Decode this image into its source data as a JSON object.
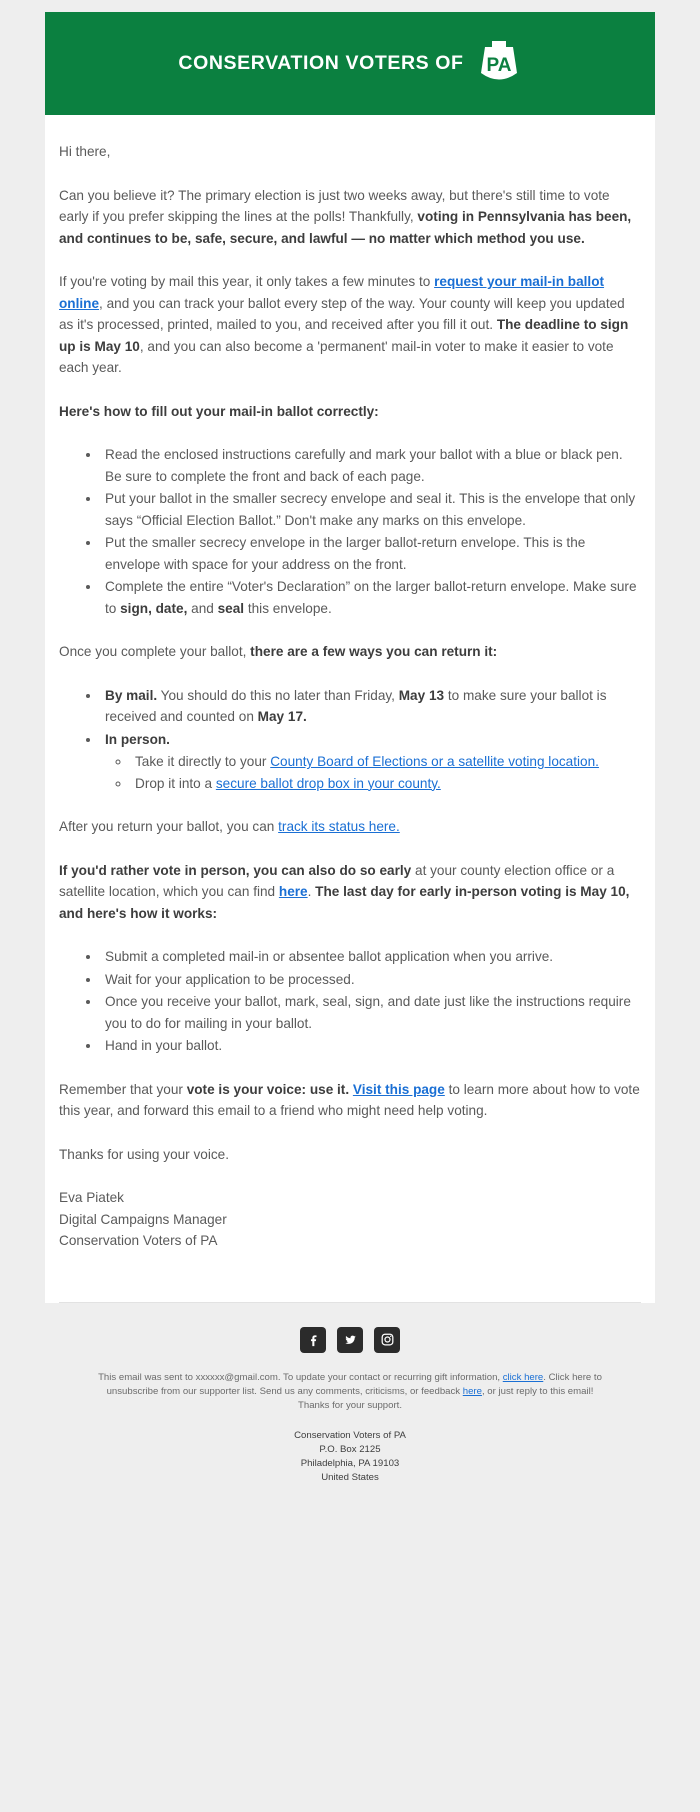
{
  "header": {
    "brand_text": "CONSERVATION VOTERS OF",
    "keystone_label": "PA"
  },
  "body": {
    "greeting": "Hi there,",
    "p1_a": "Can you believe it? The primary election is just two weeks away, but there's still time to vote early if you prefer skipping the lines at the polls! Thankfully, ",
    "p1_bold": "voting in Pennsylvania has been, and continues to be, safe, secure, and lawful — no matter which method you use.",
    "p2_a": "If you're voting by mail this year, it only takes a few minutes to ",
    "p2_link": "request your mail-in ballot online",
    "p2_b": ", and you can track your ballot every step of the way. Your county will keep you updated as it's processed, printed, mailed to you, and received after you fill it out. ",
    "p2_bold": "The deadline to sign up is May 10",
    "p2_c": ", and you can also become a 'permanent' mail-in voter to make it easier to vote each year.",
    "howto_heading": "Here's how to fill out your mail-in ballot correctly:",
    "howto_items": [
      {
        "text": "Read the enclosed instructions carefully and mark your ballot with a blue or black pen. Be sure to complete the front and back of each page."
      },
      {
        "text": "Put your ballot in the smaller secrecy envelope and seal it. This is the envelope that only says “Official Election Ballot.” Don't make any marks on this envelope."
      },
      {
        "text": "Put the smaller secrecy envelope in the larger ballot-return envelope. This is the envelope with space for your address on the front."
      }
    ],
    "howto_last_a": "Complete the entire “Voter's Declaration” on the larger ballot-return envelope. Make sure to ",
    "howto_last_b1": "sign, date,",
    "howto_last_b2": " and ",
    "howto_last_b3": "seal",
    "howto_last_b4": " this envelope.",
    "return_intro_a": "Once you complete your ballot, ",
    "return_intro_bold": "there are a few ways you can return it:",
    "bymail_bold": "By mail.",
    "bymail_a": " You should do this no later than Friday, ",
    "bymail_date1": "May 13",
    "bymail_b": " to make sure your ballot is received and counted on ",
    "bymail_date2": "May 17.",
    "inperson_bold": "In person.",
    "sub1_a": "Take it directly to your ",
    "sub1_link": "County Board of Elections or a satellite voting location.",
    "sub2_a": "Drop it into a ",
    "sub2_link": "secure ballot drop box in your county.",
    "track_a": "After you return your ballot, you can ",
    "track_link": "track its status here.",
    "early_bold1": "If you'd rather vote in person, you can also do so early",
    "early_a": " at your county election office or a satellite location, which you can find ",
    "early_link": "here",
    "early_b": ". ",
    "early_bold2": "The last day for early in-person voting is May 10, and here's how it works:",
    "early_items": [
      "Submit a completed mail-in or absentee ballot application when you arrive.",
      "Wait for your application to be processed.",
      "Once you receive your ballot, mark, seal, sign, and date just like the instructions require you to do for mailing in your ballot.",
      "Hand in your ballot."
    ],
    "closing_a": "Remember that your ",
    "closing_bold": "vote is your voice: use it.",
    "closing_b": " ",
    "closing_link": "Visit this page",
    "closing_c": " to learn more about how to vote this year, and forward this email to a friend who might need help voting.",
    "thanks": "Thanks for using your voice.",
    "sig_name": "Eva Piatek",
    "sig_title": "Digital Campaigns Manager",
    "sig_org": "Conservation Voters of PA"
  },
  "footer": {
    "socials": [
      {
        "name": "facebook-icon"
      },
      {
        "name": "twitter-icon"
      },
      {
        "name": "instagram-icon"
      }
    ],
    "fine_a": "This email was sent to ",
    "fine_email": "xxxxxx@gmail.com",
    "fine_b": ". To update your contact or recurring gift information, ",
    "fine_link1": "click here",
    "fine_c": ". Click here to unsubscribe from our supporter list. Send us any comments, criticisms, or feedback ",
    "fine_link2": "here",
    "fine_d": ", or just reply to this email! Thanks for your support.",
    "address_lines": [
      "Conservation Voters of PA",
      "P.O. Box 2125",
      "Philadelphia, PA 19103",
      "United States"
    ]
  },
  "colors": {
    "brand_green": "#0b8040",
    "link_blue": "#1a6fd4",
    "body_gray": "#5a5a5a",
    "page_bg": "#eeeeee"
  }
}
